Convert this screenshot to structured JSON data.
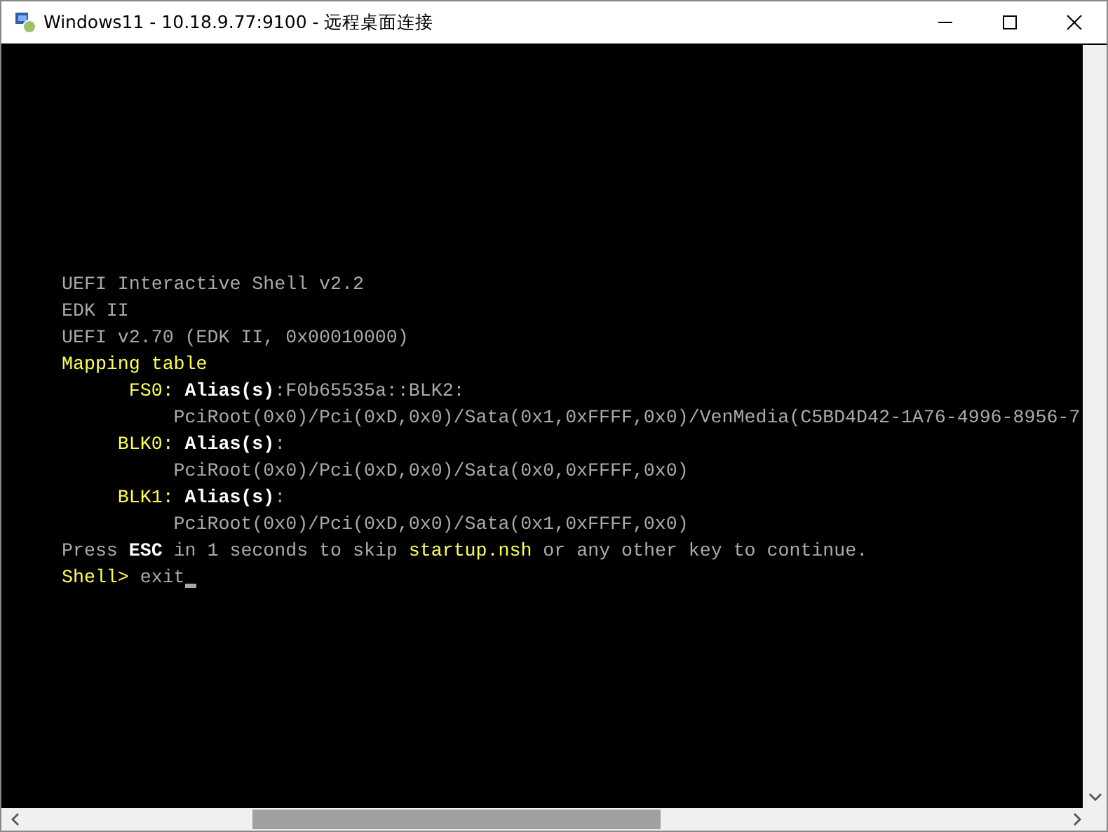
{
  "window": {
    "title": "Windows11 - 10.18.9.77:9100 - 远程桌面连接"
  },
  "console": {
    "lines": [
      {
        "segments": [
          {
            "text": "UEFI Interactive Shell v2.2",
            "color": "#aaaaaa"
          }
        ]
      },
      {
        "segments": [
          {
            "text": "EDK II",
            "color": "#aaaaaa"
          }
        ]
      },
      {
        "segments": [
          {
            "text": "UEFI v2.70 (EDK II, 0x00010000)",
            "color": "#aaaaaa"
          }
        ]
      },
      {
        "segments": [
          {
            "text": "Mapping table",
            "color": "#ffff55"
          }
        ]
      },
      {
        "segments": [
          {
            "text": "      FS0:",
            "color": "#ffff55"
          },
          {
            "text": " Alias(s)",
            "color": "#ffffff"
          },
          {
            "text": ":F0b65535a::BLK2:",
            "color": "#aaaaaa"
          }
        ]
      },
      {
        "segments": [
          {
            "text": "          PciRoot(0x0)/Pci(0xD,0x0)/Sata(0x1,0xFFFF,0x0)/VenMedia(C5BD4D42-1A76-4996-8956-7",
            "color": "#aaaaaa"
          }
        ]
      },
      {
        "segments": [
          {
            "text": "     BLK0:",
            "color": "#ffff55"
          },
          {
            "text": " Alias(s)",
            "color": "#ffffff"
          },
          {
            "text": ":",
            "color": "#aaaaaa"
          }
        ]
      },
      {
        "segments": [
          {
            "text": "          PciRoot(0x0)/Pci(0xD,0x0)/Sata(0x0,0xFFFF,0x0)",
            "color": "#aaaaaa"
          }
        ]
      },
      {
        "segments": [
          {
            "text": "     BLK1:",
            "color": "#ffff55"
          },
          {
            "text": " Alias(s)",
            "color": "#ffffff"
          },
          {
            "text": ":",
            "color": "#aaaaaa"
          }
        ]
      },
      {
        "segments": [
          {
            "text": "          PciRoot(0x0)/Pci(0xD,0x0)/Sata(0x1,0xFFFF,0x0)",
            "color": "#aaaaaa"
          }
        ]
      },
      {
        "segments": [
          {
            "text": "Press ",
            "color": "#aaaaaa"
          },
          {
            "text": "ESC",
            "color": "#ffffff"
          },
          {
            "text": " in 1 seconds to skip ",
            "color": "#aaaaaa"
          },
          {
            "text": "startup.nsh",
            "color": "#ffff55"
          },
          {
            "text": " or any other key to continue.",
            "color": "#aaaaaa"
          }
        ]
      },
      {
        "segments": [
          {
            "text": "Shell>",
            "color": "#ffff55"
          },
          {
            "text": " exit",
            "color": "#aaaaaa"
          }
        ],
        "cursor": true
      }
    ]
  }
}
